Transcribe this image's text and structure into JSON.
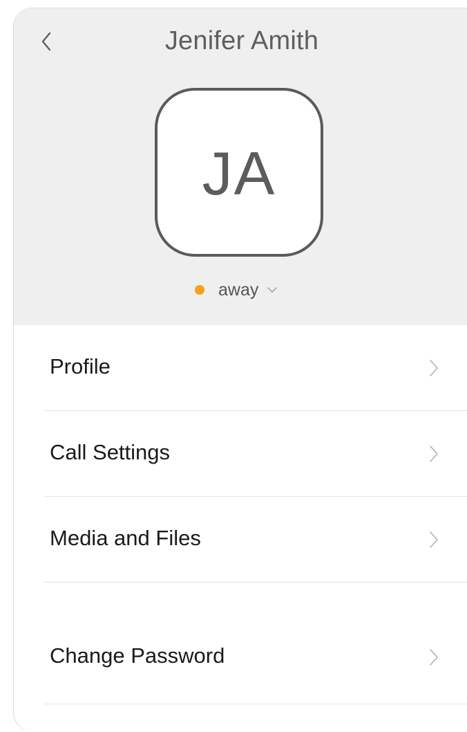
{
  "header": {
    "back_icon": "chevron-left-icon",
    "title": "Jenifer Amith",
    "avatar_initials": "JA",
    "status": {
      "label": "away",
      "color": "#f5a11e",
      "dropdown_icon": "chevron-down-icon"
    }
  },
  "menu": {
    "items": [
      {
        "label": "Profile",
        "icon": "chevron-right-icon"
      },
      {
        "label": "Call Settings",
        "icon": "chevron-right-icon"
      },
      {
        "label": "Media and Files",
        "icon": "chevron-right-icon"
      },
      {
        "label": "Change Password",
        "icon": "chevron-right-icon"
      }
    ]
  },
  "colors": {
    "header_background": "#efefef",
    "title_text": "#5e5e5e",
    "avatar_border": "#5a5a5a",
    "status_away": "#f5a11e",
    "menu_text": "#1a1a1a",
    "divider": "#e4e4e4"
  }
}
